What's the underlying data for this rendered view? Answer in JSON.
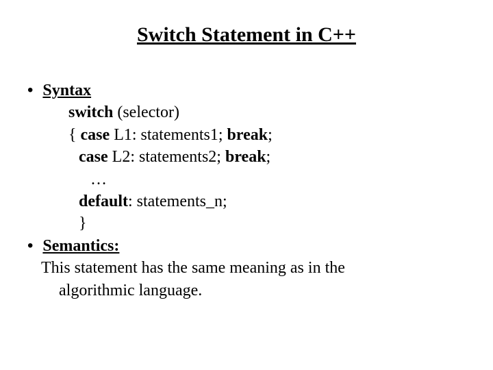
{
  "title": "Switch Statement in C++",
  "bullets": {
    "syntax_label": "Syntax",
    "semantics_label": "Semantics:"
  },
  "code": {
    "line1_kw": "switch",
    "line1_rest": " (selector)",
    "line2_brace": "{ ",
    "line2_kw": "case",
    "line2_mid": " L1: statements1; ",
    "line2_end": "break",
    "line2_semi": ";",
    "line3_kw": "case",
    "line3_mid": " L2: statements2; ",
    "line3_end": "break",
    "line3_semi": ";",
    "line4": "…",
    "line5_kw": "default",
    "line5_rest": ": statements_n;",
    "line6": "}"
  },
  "para": {
    "l1": "This statement has the same meaning as in the",
    "l2": "algorithmic language."
  }
}
